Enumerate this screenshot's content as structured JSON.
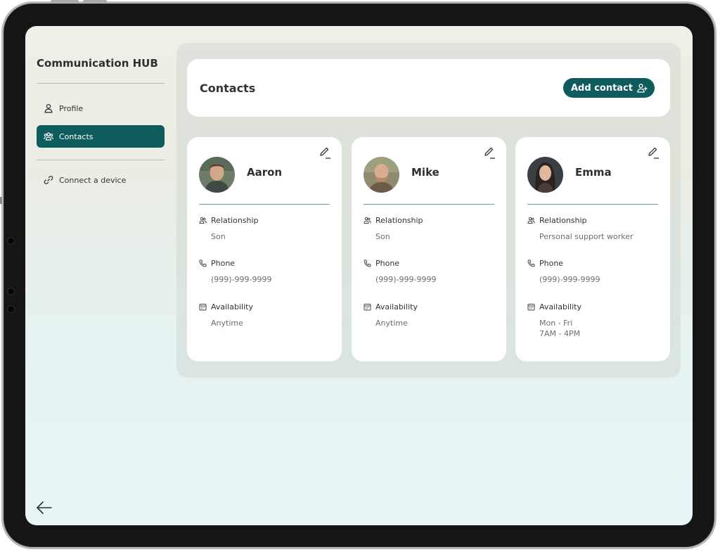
{
  "sidebar": {
    "title": "Communication HUB",
    "items": [
      {
        "label": "Profile",
        "icon": "person-icon"
      },
      {
        "label": "Contacts",
        "icon": "group-icon",
        "active": true
      },
      {
        "label": "Connect a device",
        "icon": "link-icon"
      }
    ]
  },
  "header": {
    "title": "Contacts",
    "add_button": "Add contact"
  },
  "labels": {
    "relationship": "Relationship",
    "phone": "Phone",
    "availability": "Availability"
  },
  "contacts": [
    {
      "name": "Aaron",
      "relationship": "Son",
      "phone": "(999)-999-9999",
      "availability_line1": "Anytime",
      "availability_line2": ""
    },
    {
      "name": "Mike",
      "relationship": "Son",
      "phone": "(999)-999-9999",
      "availability_line1": "Anytime",
      "availability_line2": ""
    },
    {
      "name": "Emma",
      "relationship": "Personal support worker",
      "phone": "(999)-999-9999",
      "availability_line1": "Mon - Fri",
      "availability_line2": "7AM - 4PM"
    }
  ],
  "colors": {
    "accent": "#0f5c5f",
    "card": "#ffffff",
    "rule": "#6f9fa1"
  }
}
